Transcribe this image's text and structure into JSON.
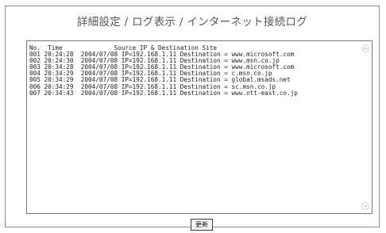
{
  "page": {
    "title": "詳細設定 / ログ表示 / インターネット接続ログ"
  },
  "log": {
    "header": "No.  Time              Source IP & Destination Site",
    "rows": [
      "001 20:24:28  2004/07/08 IP=192.168.1.11 Destination = www.microsoft.com",
      "002 20:24:30  2004/07/08 IP=192.168.1.11 Destination = www.msn.co.jp",
      "003 20:34:28  2004/07/08 IP=192.168.1.11 Destination = www.microsoft.com",
      "004 20:34:29  2004/07/08 IP=192.168.1.11 Destination = c.msn.co.jp",
      "005 20:34:29  2004/07/08 IP=192.168.1.11 Destination = global.msads.net",
      "006 20:34:29  2004/07/08 IP=192.168.1.11 Destination = sc.msn.co.jp",
      "007 20:34:43  2004/07/08 IP=192.168.1.11 Destination = www.ntt-east.co.jp"
    ]
  },
  "buttons": {
    "refresh_label": "更新"
  },
  "icons": {
    "scroll_up": "chevron-up-icon",
    "scroll_down": "chevron-down-icon"
  },
  "colors": {
    "panel_border": "#8c8c8c",
    "title_text": "#555555",
    "scroll_arrow": "#c8c8c8"
  }
}
